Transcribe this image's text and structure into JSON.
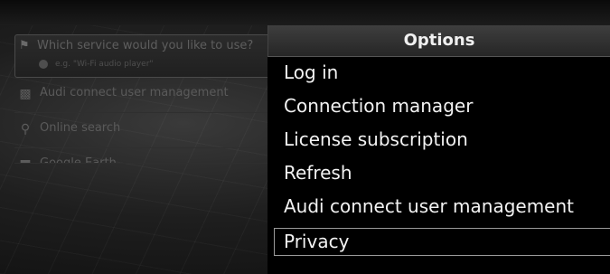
{
  "background_menu": {
    "search": {
      "icon": "search-person-icon",
      "question": "Which service would you like to use?",
      "hint": "e.g. \"Wi-Fi audio player\""
    },
    "items": [
      {
        "icon": "user-management-icon",
        "label": "Audi connect user management"
      },
      {
        "icon": "search-icon",
        "label": "Online search"
      },
      {
        "icon": "app-icon",
        "label": "Google Earth"
      }
    ]
  },
  "options": {
    "title": "Options",
    "items": [
      {
        "label": "Log in",
        "selected": false
      },
      {
        "label": "Connection manager",
        "selected": false
      },
      {
        "label": "License subscription",
        "selected": false
      },
      {
        "label": "Refresh",
        "selected": false
      },
      {
        "label": "Audi connect user management",
        "selected": false
      },
      {
        "label": "Privacy",
        "selected": true
      }
    ]
  }
}
